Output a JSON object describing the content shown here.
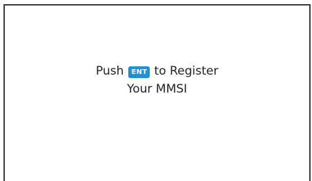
{
  "dialog": {
    "prompt_prefix": "Push",
    "key_label": "ENT",
    "prompt_suffix": "to Register",
    "line2": "Your MMSI"
  },
  "colors": {
    "key_background": "#1f8fd8",
    "key_text": "#ffffff",
    "text": "#222222",
    "border": "#3a3a3a"
  }
}
